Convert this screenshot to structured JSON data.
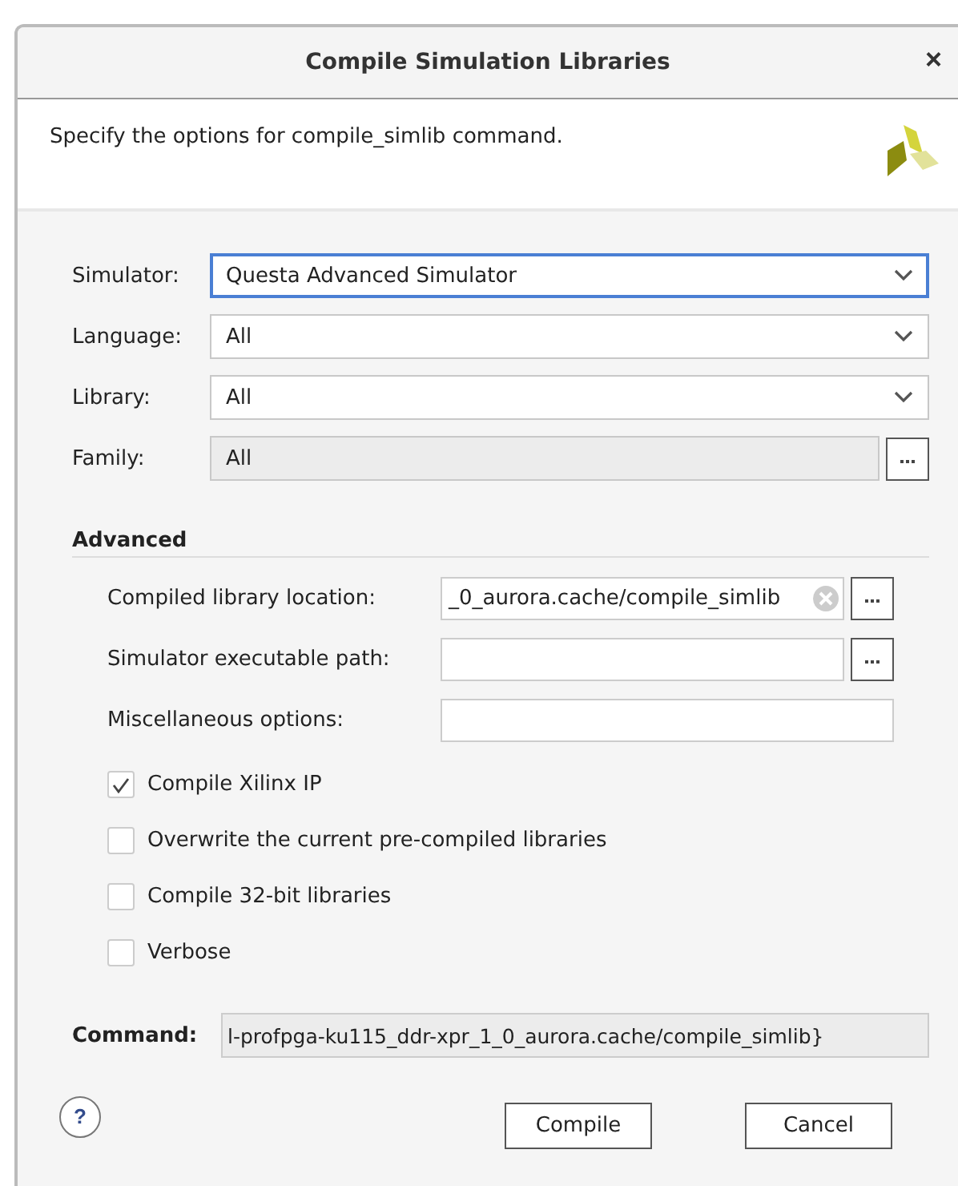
{
  "window": {
    "title": "Compile Simulation Libraries",
    "close": "×"
  },
  "description": "Specify the options for compile_simlib command.",
  "fields": [
    {
      "label": "Simulator:",
      "kind": "dropdown",
      "value": "Questa Advanced Simulator",
      "focused": true
    },
    {
      "label": "Language:",
      "kind": "dropdown",
      "value": "All",
      "focused": false
    },
    {
      "label": "Library:",
      "kind": "dropdown",
      "value": "All",
      "focused": false
    },
    {
      "label": "Family:",
      "kind": "browse",
      "value": "All",
      "focused": false
    }
  ],
  "advanced": {
    "title": "Advanced",
    "fields": [
      {
        "label": "Compiled library location:",
        "kind": "path",
        "value": "_0_aurora.cache/compile_simlib",
        "clearable": true
      },
      {
        "label": "Simulator executable path:",
        "kind": "path",
        "clearable": false
      },
      {
        "label": "Miscellaneous options:",
        "kind": "text",
        "clearable": false
      }
    ],
    "options": [
      {
        "label": "Compile Xilinx IP",
        "checked": true
      },
      {
        "label": "Overwrite the current pre-compiled libraries",
        "checked": false
      },
      {
        "label": "Compile 32-bit libraries",
        "checked": false
      },
      {
        "label": "Verbose",
        "checked": false
      }
    ]
  },
  "command": {
    "label": "Command:",
    "value": "l-profpga-ku115_ddr-xpr_1_0_aurora.cache/compile_simlib}"
  },
  "help": "?",
  "buttons": [
    "Compile",
    "Cancel"
  ]
}
